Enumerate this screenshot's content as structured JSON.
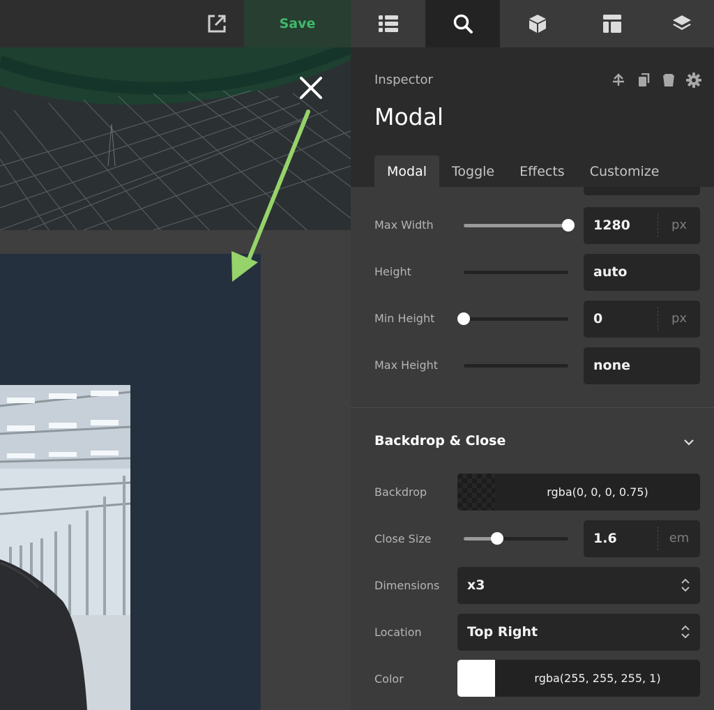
{
  "toolbar": {
    "save_label": "Save",
    "icons": [
      "external-link-icon",
      "list-icon",
      "search-icon",
      "cube-icon",
      "layout-icon",
      "layers-icon"
    ]
  },
  "inspector": {
    "label": "Inspector",
    "title": "Modal",
    "header_icons": [
      "move-up-icon",
      "copy-icon",
      "trash-icon",
      "gear-icon"
    ],
    "tabs": [
      {
        "label": "Modal",
        "active": true
      },
      {
        "label": "Toggle",
        "active": false
      },
      {
        "label": "Effects",
        "active": false
      },
      {
        "label": "Customize",
        "active": false
      }
    ],
    "dimensions": {
      "max_width": {
        "label": "Max Width",
        "value": "1280",
        "unit": "px",
        "slider_level": 1.0
      },
      "height": {
        "label": "Height",
        "value": "auto"
      },
      "min_height": {
        "label": "Min Height",
        "value": "0",
        "unit": "px",
        "slider_level": 0.0
      },
      "max_height": {
        "label": "Max Height",
        "value": "none"
      }
    },
    "backdrop_section": {
      "title": "Backdrop & Close",
      "backdrop": {
        "label": "Backdrop",
        "value": "rgba(0, 0, 0, 0.75)"
      },
      "close_size": {
        "label": "Close Size",
        "value": "1.6",
        "unit": "em",
        "slider_level": 0.32
      },
      "dimensions": {
        "label": "Dimensions",
        "value": "x3"
      },
      "location": {
        "label": "Location",
        "value": "Top Right"
      },
      "color": {
        "label": "Color",
        "value": "rgba(255, 255, 255, 1)"
      }
    }
  },
  "colors": {
    "accent_save": "#3fb96b",
    "annotation_arrow": "#96d36a",
    "modal_bg": "#25303f"
  }
}
